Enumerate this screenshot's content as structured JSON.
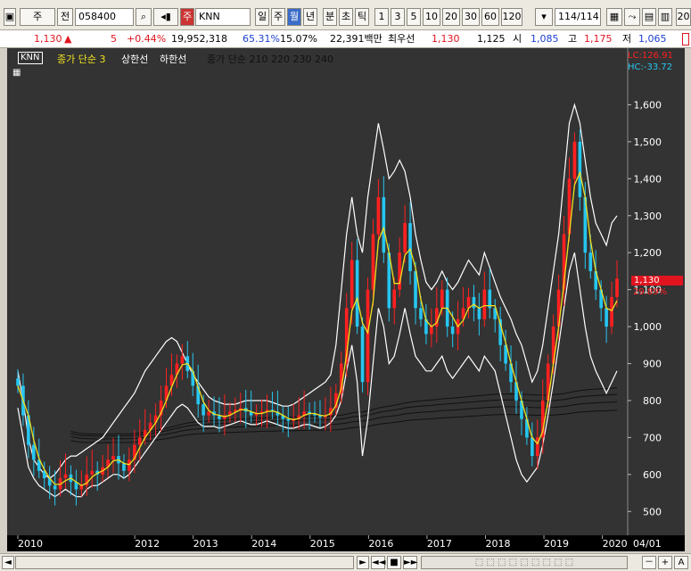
{
  "toolbar": {
    "market": "주",
    "jeon": "전",
    "code": "058400",
    "stock_badge": "주",
    "stock_name": "KNN",
    "periods": [
      "일",
      "주",
      "월",
      "년",
      "분",
      "초",
      "틱"
    ],
    "active_period": "월",
    "numbers": [
      "1",
      "3",
      "5",
      "10",
      "20",
      "30",
      "60",
      "120"
    ],
    "count": "114/114",
    "trailing": "20"
  },
  "info": {
    "price": "1,130",
    "arrow": "▲",
    "change": "5",
    "change_pct": "+0.44%",
    "volume": "19,952,318",
    "ratio1": "65.31%",
    "ratio2": "15.07%",
    "amount": "22,391백만",
    "best_label": "최우선",
    "best1": "1,130",
    "best2": "1,125",
    "open_label": "시",
    "open": "1,085",
    "high_label": "고",
    "high": "1,175",
    "low_label": "저",
    "low": "1,065"
  },
  "legend": {
    "symbol": "KNN",
    "ma": "종가 단순 3",
    "upper": "상한선",
    "lower": "하한선",
    "ma_multi": "종가 단순 210 220 230 240"
  },
  "overlay": {
    "lc": "LC:126.91",
    "hc": "HC:-33.72",
    "current": "1,130",
    "current_pct": "29.89%"
  },
  "colors": {
    "up": "#ff2020",
    "down": "#26c6f0",
    "ma": "#f0e020",
    "band": "#ffffff",
    "long_ma": "#111111",
    "bg": "#333333"
  },
  "chart_data": {
    "type": "candlestick",
    "interval": "monthly",
    "x_labels": [
      "2010",
      "2012",
      "2013",
      "2014",
      "2015",
      "2016",
      "2017",
      "2018",
      "2019",
      "2020",
      "04/01"
    ],
    "y_ticks": [
      500,
      600,
      700,
      800,
      900,
      1000,
      1100,
      1200,
      1300,
      1400,
      1500,
      1600
    ],
    "y_tick_labels": [
      "500",
      "600",
      "700",
      "800",
      "900",
      "1,000",
      "1,100",
      "1,200",
      "1,300",
      "1,400",
      "1,500",
      "1,600"
    ],
    "ylim": [
      450,
      1700
    ],
    "x_year_start": 2010,
    "x_year_end": 2020.25,
    "closes": [
      840,
      760,
      680,
      640,
      610,
      590,
      570,
      560,
      590,
      600,
      580,
      560,
      570,
      600,
      610,
      600,
      620,
      640,
      650,
      630,
      610,
      640,
      680,
      700,
      720,
      740,
      760,
      800,
      840,
      870,
      900,
      920,
      880,
      840,
      790,
      760,
      770,
      760,
      750,
      760,
      770,
      775,
      780,
      770,
      760,
      765,
      770,
      775,
      770,
      760,
      750,
      745,
      750,
      760,
      770,
      765,
      760,
      755,
      760,
      780,
      820,
      900,
      1050,
      1180,
      1000,
      850,
      1100,
      1250,
      1350,
      1200,
      1050,
      1100,
      1200,
      1280,
      1150,
      1050,
      1020,
      980,
      1000,
      1050,
      1100,
      1000,
      980,
      1020,
      1050,
      1080,
      1050,
      1020,
      1100,
      1050,
      1020,
      950,
      900,
      850,
      800,
      750,
      700,
      650,
      700,
      800,
      900,
      1000,
      1100,
      1250,
      1400,
      1500,
      1350,
      1200,
      1150,
      1100,
      1050,
      1000,
      1080,
      1130
    ],
    "upper_band": [
      880,
      800,
      700,
      640,
      620,
      600,
      590,
      600,
      620,
      640,
      650,
      650,
      660,
      670,
      680,
      690,
      700,
      720,
      740,
      760,
      780,
      800,
      820,
      850,
      880,
      900,
      920,
      940,
      960,
      970,
      960,
      930,
      900,
      870,
      850,
      830,
      810,
      800,
      795,
      790,
      790,
      790,
      795,
      800,
      800,
      800,
      800,
      800,
      795,
      790,
      785,
      785,
      790,
      800,
      810,
      820,
      830,
      840,
      850,
      870,
      950,
      1100,
      1250,
      1350,
      1250,
      1200,
      1350,
      1450,
      1550,
      1480,
      1400,
      1420,
      1450,
      1420,
      1350,
      1250,
      1180,
      1120,
      1100,
      1120,
      1150,
      1120,
      1100,
      1120,
      1150,
      1180,
      1160,
      1140,
      1200,
      1160,
      1120,
      1080,
      1050,
      1020,
      980,
      950,
      900,
      850,
      880,
      950,
      1050,
      1150,
      1250,
      1400,
      1550,
      1600,
      1550,
      1450,
      1350,
      1280,
      1250,
      1220,
      1280,
      1300
    ],
    "lower_band": [
      780,
      700,
      620,
      590,
      570,
      560,
      550,
      540,
      550,
      560,
      550,
      540,
      540,
      560,
      570,
      570,
      580,
      590,
      600,
      600,
      590,
      600,
      620,
      640,
      660,
      680,
      700,
      720,
      740,
      760,
      780,
      790,
      780,
      760,
      740,
      730,
      730,
      730,
      725,
      730,
      735,
      740,
      745,
      740,
      735,
      735,
      740,
      745,
      740,
      735,
      730,
      725,
      725,
      730,
      735,
      735,
      730,
      725,
      730,
      740,
      760,
      800,
      880,
      950,
      850,
      650,
      750,
      900,
      1050,
      1000,
      900,
      920,
      980,
      1050,
      980,
      920,
      900,
      880,
      880,
      900,
      920,
      880,
      860,
      880,
      900,
      920,
      900,
      880,
      920,
      900,
      880,
      820,
      760,
      700,
      640,
      600,
      580,
      600,
      620,
      680,
      760,
      850,
      950,
      1050,
      1150,
      1200,
      1100,
      1000,
      920,
      880,
      850,
      820,
      850,
      880
    ],
    "long_ma_levels": [
      720,
      745,
      770,
      795
    ]
  },
  "scrollbar": {
    "left_arrow": "◄",
    "right_arrow": "►",
    "buttons": [
      "►",
      "◄◄",
      "■",
      "►►"
    ],
    "zoom": [
      "－",
      "+",
      "A"
    ]
  }
}
